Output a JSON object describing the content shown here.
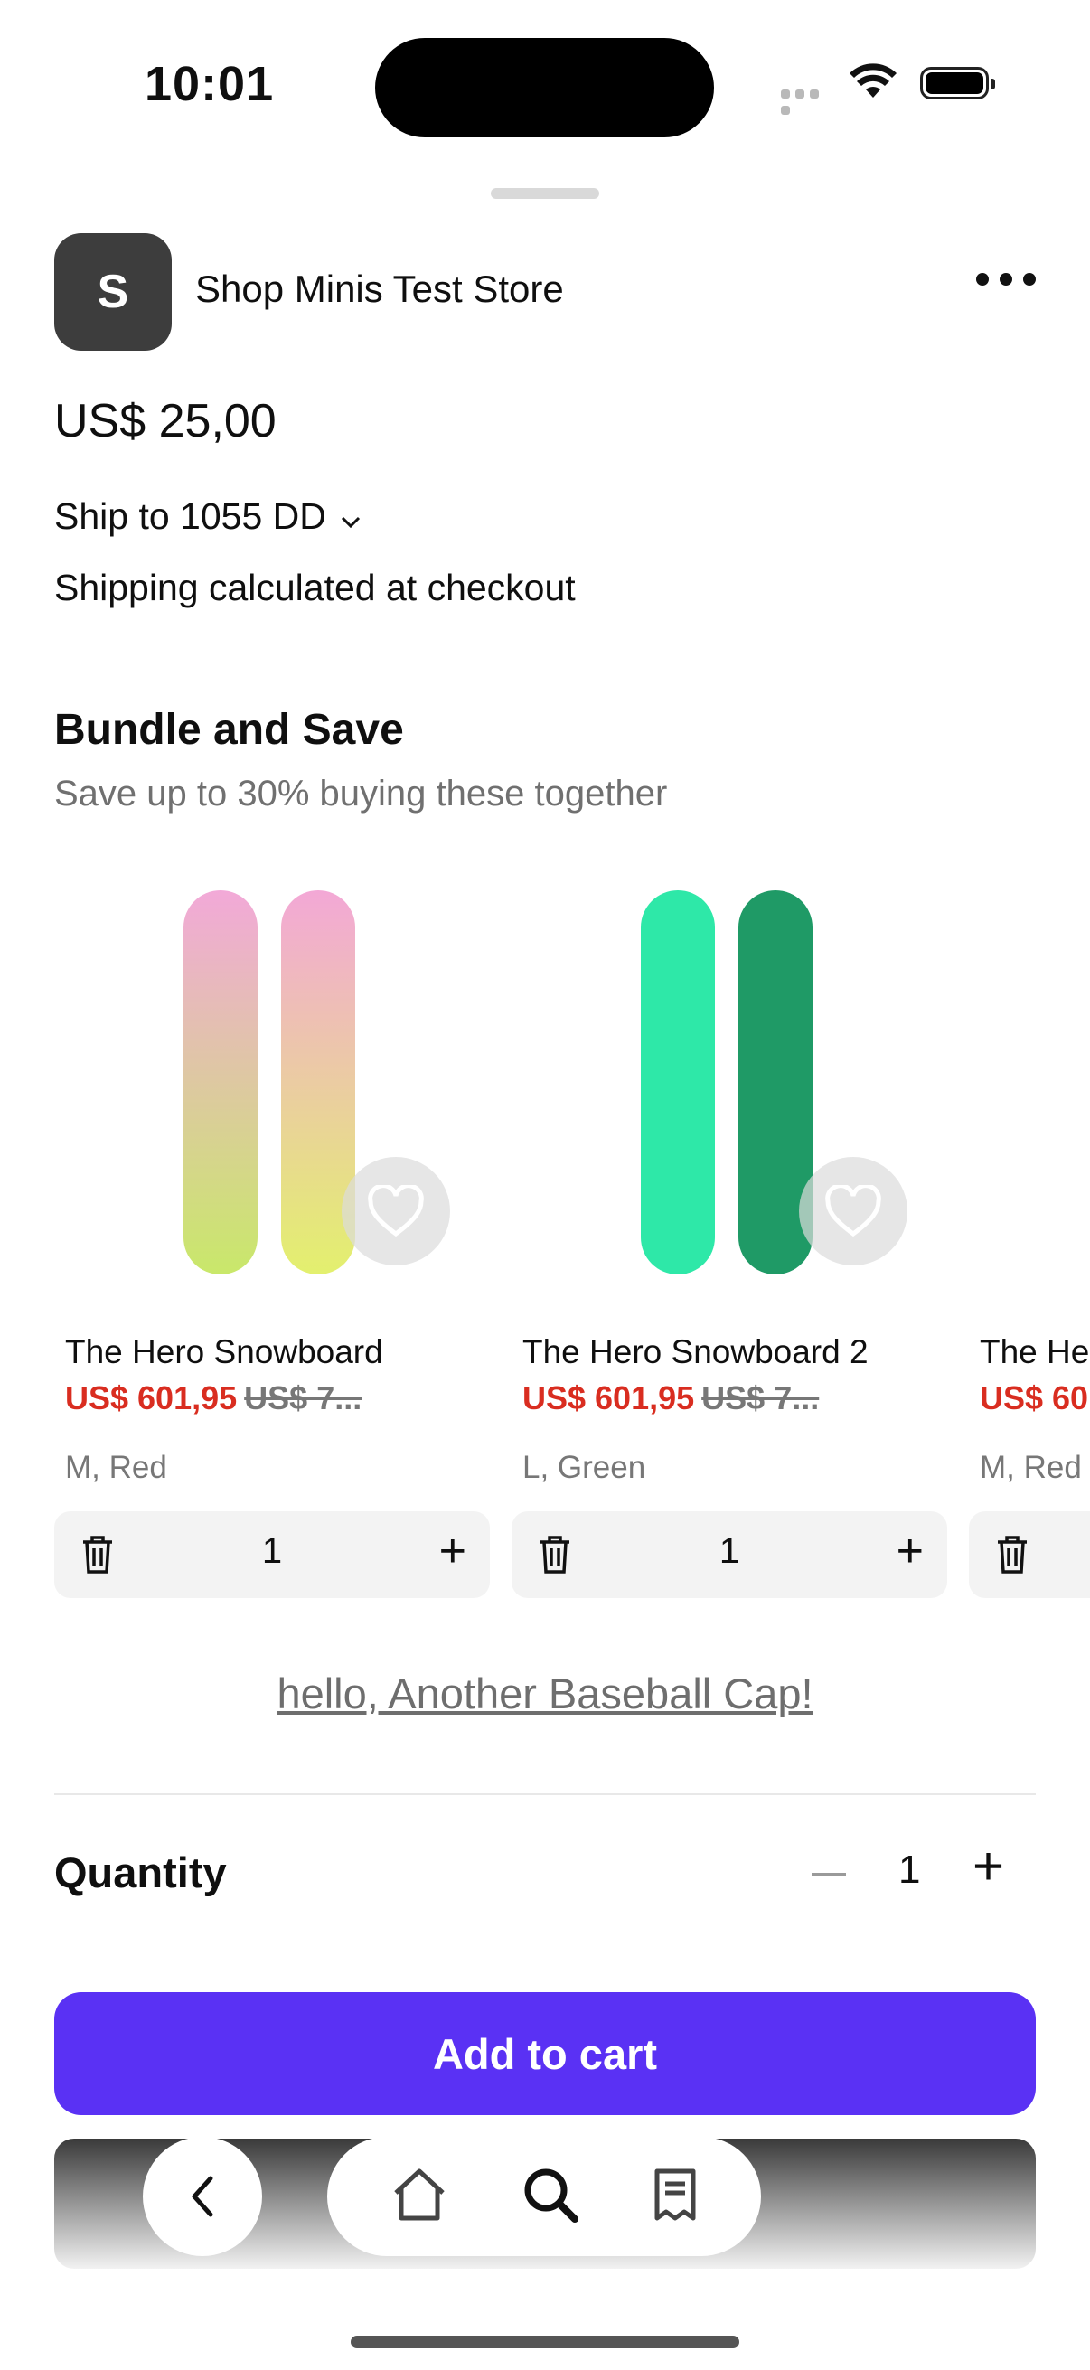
{
  "status_bar": {
    "time": "10:01"
  },
  "store": {
    "logo_letter": "S",
    "name": "Shop Minis Test Store"
  },
  "price": "US$ 25,00",
  "shipping": {
    "ship_to": "Ship to 1055 DD",
    "note": "Shipping calculated at checkout"
  },
  "bundle": {
    "title": "Bundle and Save",
    "subtitle": "Save up to 30% buying these together",
    "products": [
      {
        "name": "The Hero Snowboard",
        "sale_price": "US$ 601,95",
        "original_price": "US$ 7...",
        "variant": "M, Red",
        "qty": "1"
      },
      {
        "name": "The Hero Snowboard 2",
        "sale_price": "US$ 601,95",
        "original_price": "US$ 7...",
        "variant": "L, Green",
        "qty": "1"
      },
      {
        "name": "The He",
        "sale_price": "US$ 60",
        "original_price": "",
        "variant": "M, Red",
        "qty": ""
      }
    ]
  },
  "link_text": "hello, Another Baseball Cap!",
  "quantity": {
    "label": "Quantity",
    "value": "1"
  },
  "add_to_cart": "Add to cart",
  "colors": {
    "accent": "#5a31f4",
    "sale": "#d92d20"
  }
}
